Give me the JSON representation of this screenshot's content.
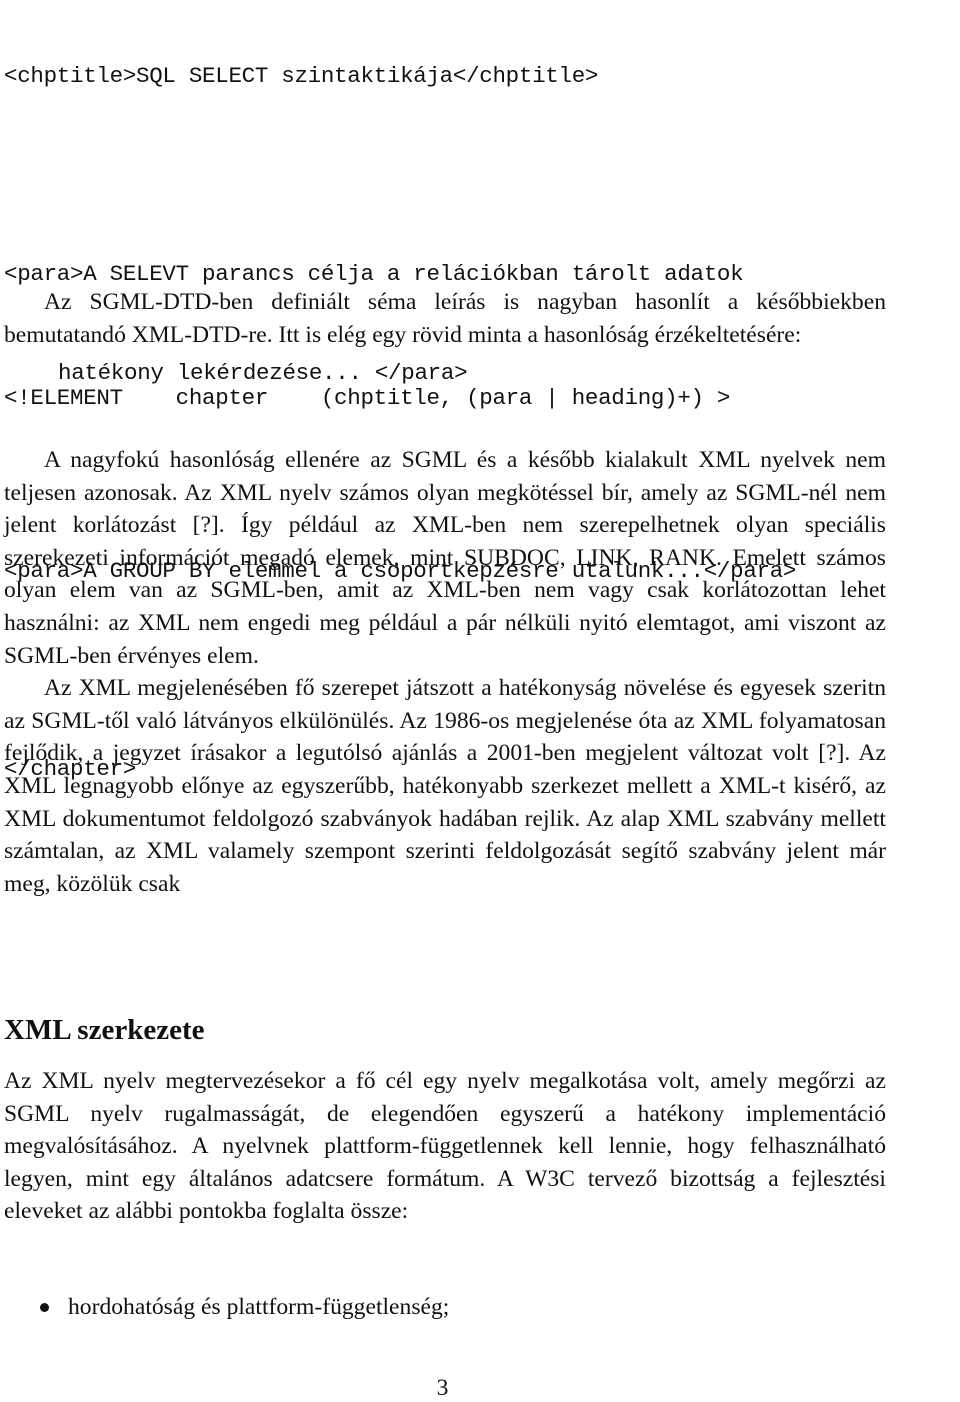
{
  "code_sample": {
    "line1": "<chptitle>SQL SELECT szintaktikája</chptitle>",
    "line2": "<para>A SELEVT parancs célja a relációkban tárolt adatok",
    "line2_cont": "hatékony lekérdezése... </para>",
    "line3": "<para>A GROUP BY elemmel a csoportképzésre utalunk...</para>",
    "line4": "</chapter>"
  },
  "intro_paragraph": "Az SGML-DTD-ben definiált séma leírás is nagyban hasonlít a későbbiekben bemutatandó XML-DTD-re. Itt is elég egy rövid minta a hasonlóság érzékeltetésére:",
  "element_declaration": "<!ELEMENT    chapter    (chptitle, (para | heading)+) >",
  "paragraphs": [
    "A nagyfokú hasonlóság ellenére az SGML és a később kialakult XML nyelvek nem teljesen azonosak. Az XML nyelv számos olyan megkötéssel bír, amely az SGML-nél nem jelent korlátozást [?]. Így például az XML-ben nem szerepelhetnek olyan speciális szerekezeti információt megadó elemek, mint SUBDOC, LINK, RANK. Emelett számos olyan elem van az SGML-ben, amit az XML-ben nem vagy csak korlátozottan lehet használni: az XML nem engedi meg például a pár nélküli nyitó elemtagot, ami viszont az SGML-ben érvényes elem.",
    "Az XML megjelenésében fő szerepet játszott a hatékonyság növelése és egyesek szeritn az SGML-től való látványos elkülönülés. Az 1986-os meg­jelenése óta az XML folyamatosan fejlődik, a jegyzet írásakor a legutólsó ajánlás a 2001-ben megjelent változat volt [?]. Az XML legnagyobb előnye az egyszerűbb, hatékonyabb szerkezet mellett a XML-t kisérő, az XML doku­mentumot feldolgozó szabványok hadában rejlik. Az alap XML szabvány mellett számtalan, az XML valamely szempont szerinti feldolgozását segítő szabvány jelent már meg, közölük csak"
  ],
  "section": {
    "title": "XML szerkezete",
    "paragraph": "Az XML nyelv megtervezésekor a fő cél egy nyelv megalkotása volt, amely megőrzi az SGML nyelv rugalmasságát, de elegendően egyszerű a hatékony implementáció megvalósításához. A nyelvnek plattform-függetlennek kell lennie, hogy felhasználható legyen, mint egy általános adatcsere formátum. A W3C tervező bizottság a fejlesztési eleveket az alábbi pontokba foglalta össze:",
    "list_items": [
      "hordohatóság és plattform-függetlenség;"
    ]
  },
  "page_number": "3"
}
